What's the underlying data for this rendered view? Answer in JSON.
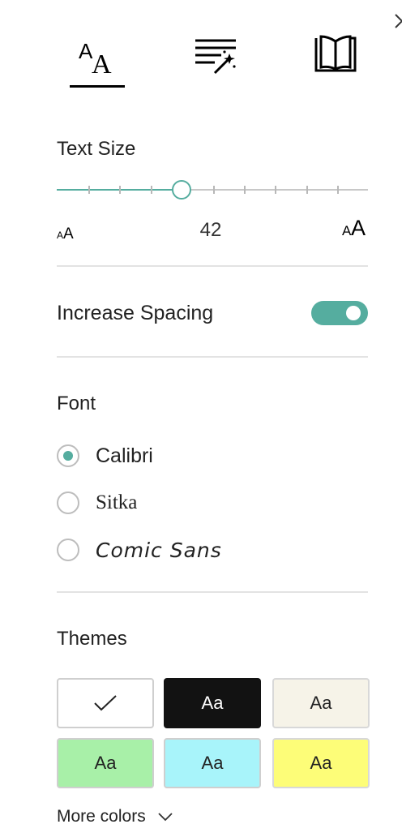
{
  "tabs": [
    {
      "name": "text-options",
      "icon": "text-size-icon",
      "selected": true
    },
    {
      "name": "grammar-tools",
      "icon": "grammar-tools-icon",
      "selected": false
    },
    {
      "name": "reading-preferences",
      "icon": "book-icon",
      "selected": false
    }
  ],
  "text_size": {
    "title": "Text Size",
    "value": "42",
    "slider_position_fraction": 0.4
  },
  "spacing": {
    "label": "Increase Spacing",
    "enabled": true
  },
  "font": {
    "title": "Font",
    "options": [
      "Calibri",
      "Sitka",
      "Comic Sans"
    ],
    "selected": "Calibri"
  },
  "themes": {
    "title": "Themes",
    "swatches": [
      {
        "label": "",
        "bg": "#ffffff",
        "fg": "#222222",
        "selected": true
      },
      {
        "label": "Aa",
        "bg": "#121212",
        "fg": "#ffffff",
        "selected": false
      },
      {
        "label": "Aa",
        "bg": "#f6f3e8",
        "fg": "#222222",
        "selected": false
      },
      {
        "label": "Aa",
        "bg": "#a8f0a8",
        "fg": "#222222",
        "selected": false
      },
      {
        "label": "Aa",
        "bg": "#a8f4fa",
        "fg": "#222222",
        "selected": false
      },
      {
        "label": "Aa",
        "bg": "#fdfd78",
        "fg": "#222222",
        "selected": false
      }
    ],
    "more_colors": "More colors"
  },
  "colors": {
    "accent": "#55ad9f",
    "divider": "#e3e3e3"
  }
}
